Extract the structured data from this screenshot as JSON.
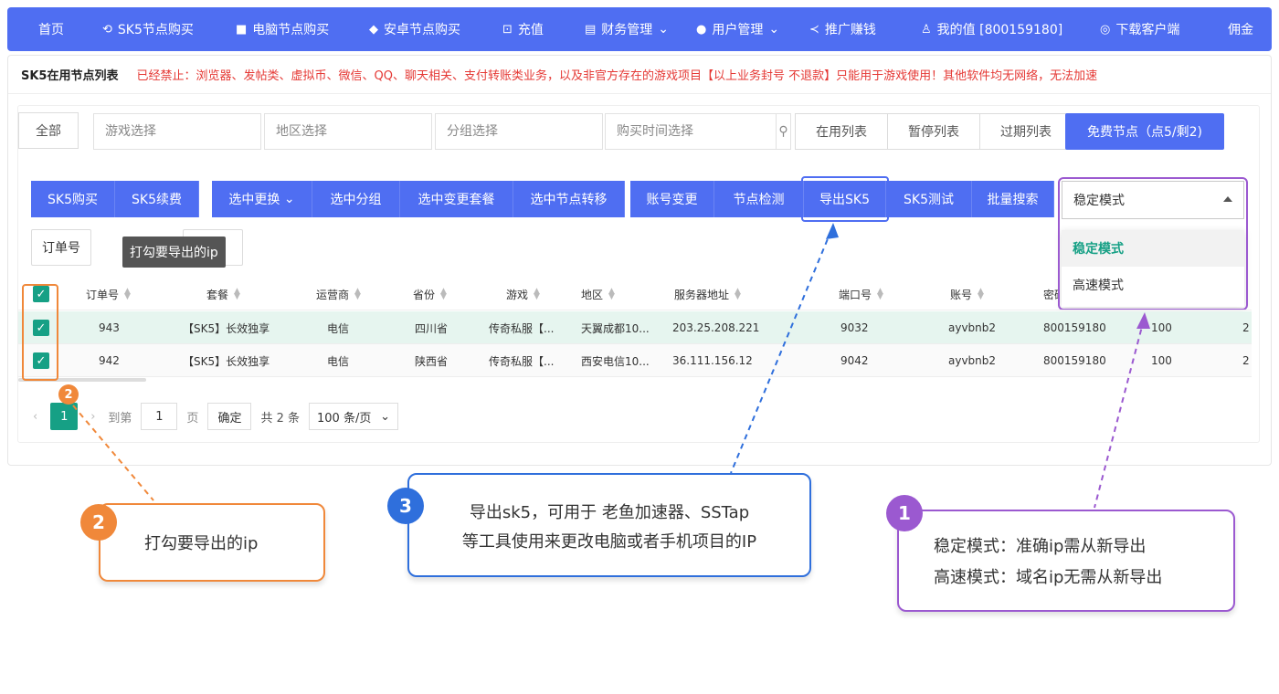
{
  "nav": {
    "items": [
      {
        "label": "首页",
        "icon": ""
      },
      {
        "label": "SK5节点购买",
        "icon": "refresh-icon"
      },
      {
        "label": "电脑节点购买",
        "icon": "windows-icon"
      },
      {
        "label": "安卓节点购买",
        "icon": "android-icon"
      },
      {
        "label": "充值",
        "icon": "cart-icon"
      },
      {
        "label": "财务管理",
        "icon": "finance-icon"
      },
      {
        "label": "用户管理",
        "icon": "users-icon"
      },
      {
        "label": "推广赚钱",
        "icon": "share-icon"
      },
      {
        "label": "我的值 [800159180]",
        "icon": "user-icon"
      },
      {
        "label": "下载客户端",
        "icon": "download-icon"
      },
      {
        "label": "佣金",
        "icon": ""
      }
    ]
  },
  "page": {
    "title": "SK5在用节点列表",
    "warning": "已经禁止：浏览器、发帖类、虚拟币、微信、QQ、聊天相关、支付转账类业务，以及非官方存在的游戏项目【以上业务封号 不退款】只能用于游戏使用！其他软件均无网络，无法加速"
  },
  "filters": {
    "all": "全部",
    "game_placeholder": "游戏选择",
    "region_placeholder": "地区选择",
    "group_placeholder": "分组选择",
    "time_placeholder": "购买时间选择",
    "tabs": [
      "在用列表",
      "暂停列表",
      "过期列表"
    ],
    "free_nodes": "免费节点（点5/剩2)"
  },
  "actions": {
    "group1": [
      "SK5购买",
      "SK5续费"
    ],
    "group2": [
      "选中更换",
      "选中分组",
      "选中变更套餐",
      "选中节点转移"
    ],
    "group3": [
      "账号变更",
      "节点检测",
      "导出SK5",
      "SK5测试",
      "批量搜索"
    ]
  },
  "mode_select": {
    "value": "稳定模式",
    "options": [
      "稳定模式",
      "高速模式"
    ]
  },
  "order_button": "订单号",
  "tooltip": "打勾要导出的ip",
  "table": {
    "columns": [
      "订单号",
      "套餐",
      "运营商",
      "省份",
      "游戏",
      "地区",
      "服务器地址",
      "端口号",
      "账号",
      "密码"
    ],
    "rows": [
      {
        "order": "943",
        "plan": "【SK5】长效独享",
        "isp": "电信",
        "province": "四川省",
        "game": "传奇私服【...",
        "region": "天翼成都10...",
        "server": "203.25.208.221",
        "port": "9032",
        "account": "ayvbnb2",
        "password": "800159180",
        "extra1": "100",
        "extra2": "2"
      },
      {
        "order": "942",
        "plan": "【SK5】长效独享",
        "isp": "电信",
        "province": "陕西省",
        "game": "传奇私服【...",
        "region": "西安电信10...",
        "server": "36.111.156.12",
        "port": "9042",
        "account": "ayvbnb2",
        "password": "800159180",
        "extra1": "100",
        "extra2": "2"
      }
    ]
  },
  "pager": {
    "current": "1",
    "goto_label": "到第",
    "goto_value": "1",
    "page_unit": "页",
    "confirm": "确定",
    "total": "共 2 条",
    "page_size": "100 条/页"
  },
  "callouts": {
    "c1": {
      "badge": "1",
      "line1": "稳定模式：准确ip需从新导出",
      "line2": "高速模式：域名ip无需从新导出"
    },
    "c2": {
      "badge": "2",
      "text": "打勾要导出的ip",
      "small_badge": "2"
    },
    "c3": {
      "badge": "3",
      "line1": "导出sk5，可用于 老鱼加速器、SSTap",
      "line2": "等工具使用来更改电脑或者手机项目的IP"
    }
  },
  "colors": {
    "primary": "#4f6ef2",
    "warning": "#e53935",
    "check": "#16a085",
    "orange": "#f0883a",
    "blue_callout": "#2f6fdc",
    "purple": "#9b59d0"
  }
}
